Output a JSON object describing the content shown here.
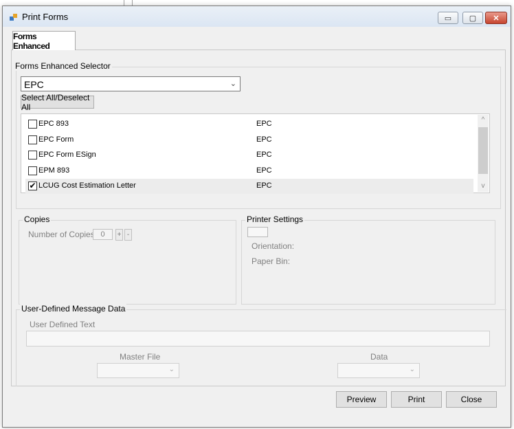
{
  "window": {
    "title": "Print Forms",
    "controls": {
      "minimize": "▭",
      "maximize": "▢",
      "close": "✕"
    }
  },
  "tab": {
    "label": "Forms Enhanced"
  },
  "selector": {
    "group_label": "Forms Enhanced Selector",
    "combo_value": "EPC",
    "select_all_label": "Select All/Deselect All",
    "items": [
      {
        "name": "EPC 893",
        "type": "EPC",
        "checked": false,
        "check": ""
      },
      {
        "name": "EPC Form",
        "type": "EPC",
        "checked": false,
        "check": ""
      },
      {
        "name": "EPC Form ESign",
        "type": "EPC",
        "checked": false,
        "check": ""
      },
      {
        "name": "EPM 893",
        "type": "EPC",
        "checked": false,
        "check": ""
      },
      {
        "name": "LCUG Cost Estimation Letter",
        "type": "EPC",
        "checked": true,
        "check": "✔"
      }
    ]
  },
  "copies": {
    "group_label": "Copies",
    "number_label": "Number of Copies:",
    "value": "0",
    "plus": "+",
    "minus": "-"
  },
  "printer": {
    "group_label": "Printer Settings",
    "orientation_label": "Orientation:",
    "paper_bin_label": "Paper Bin:"
  },
  "message": {
    "group_label": "User-Defined Message Data",
    "text_label": "User Defined Text",
    "master_file_label": "Master File",
    "data_label": "Data"
  },
  "buttons": {
    "preview": "Preview",
    "print": "Print",
    "close": "Close"
  },
  "icons": {
    "combo_arrow": "⌄",
    "scroll_up": "^",
    "scroll_down": "v"
  }
}
